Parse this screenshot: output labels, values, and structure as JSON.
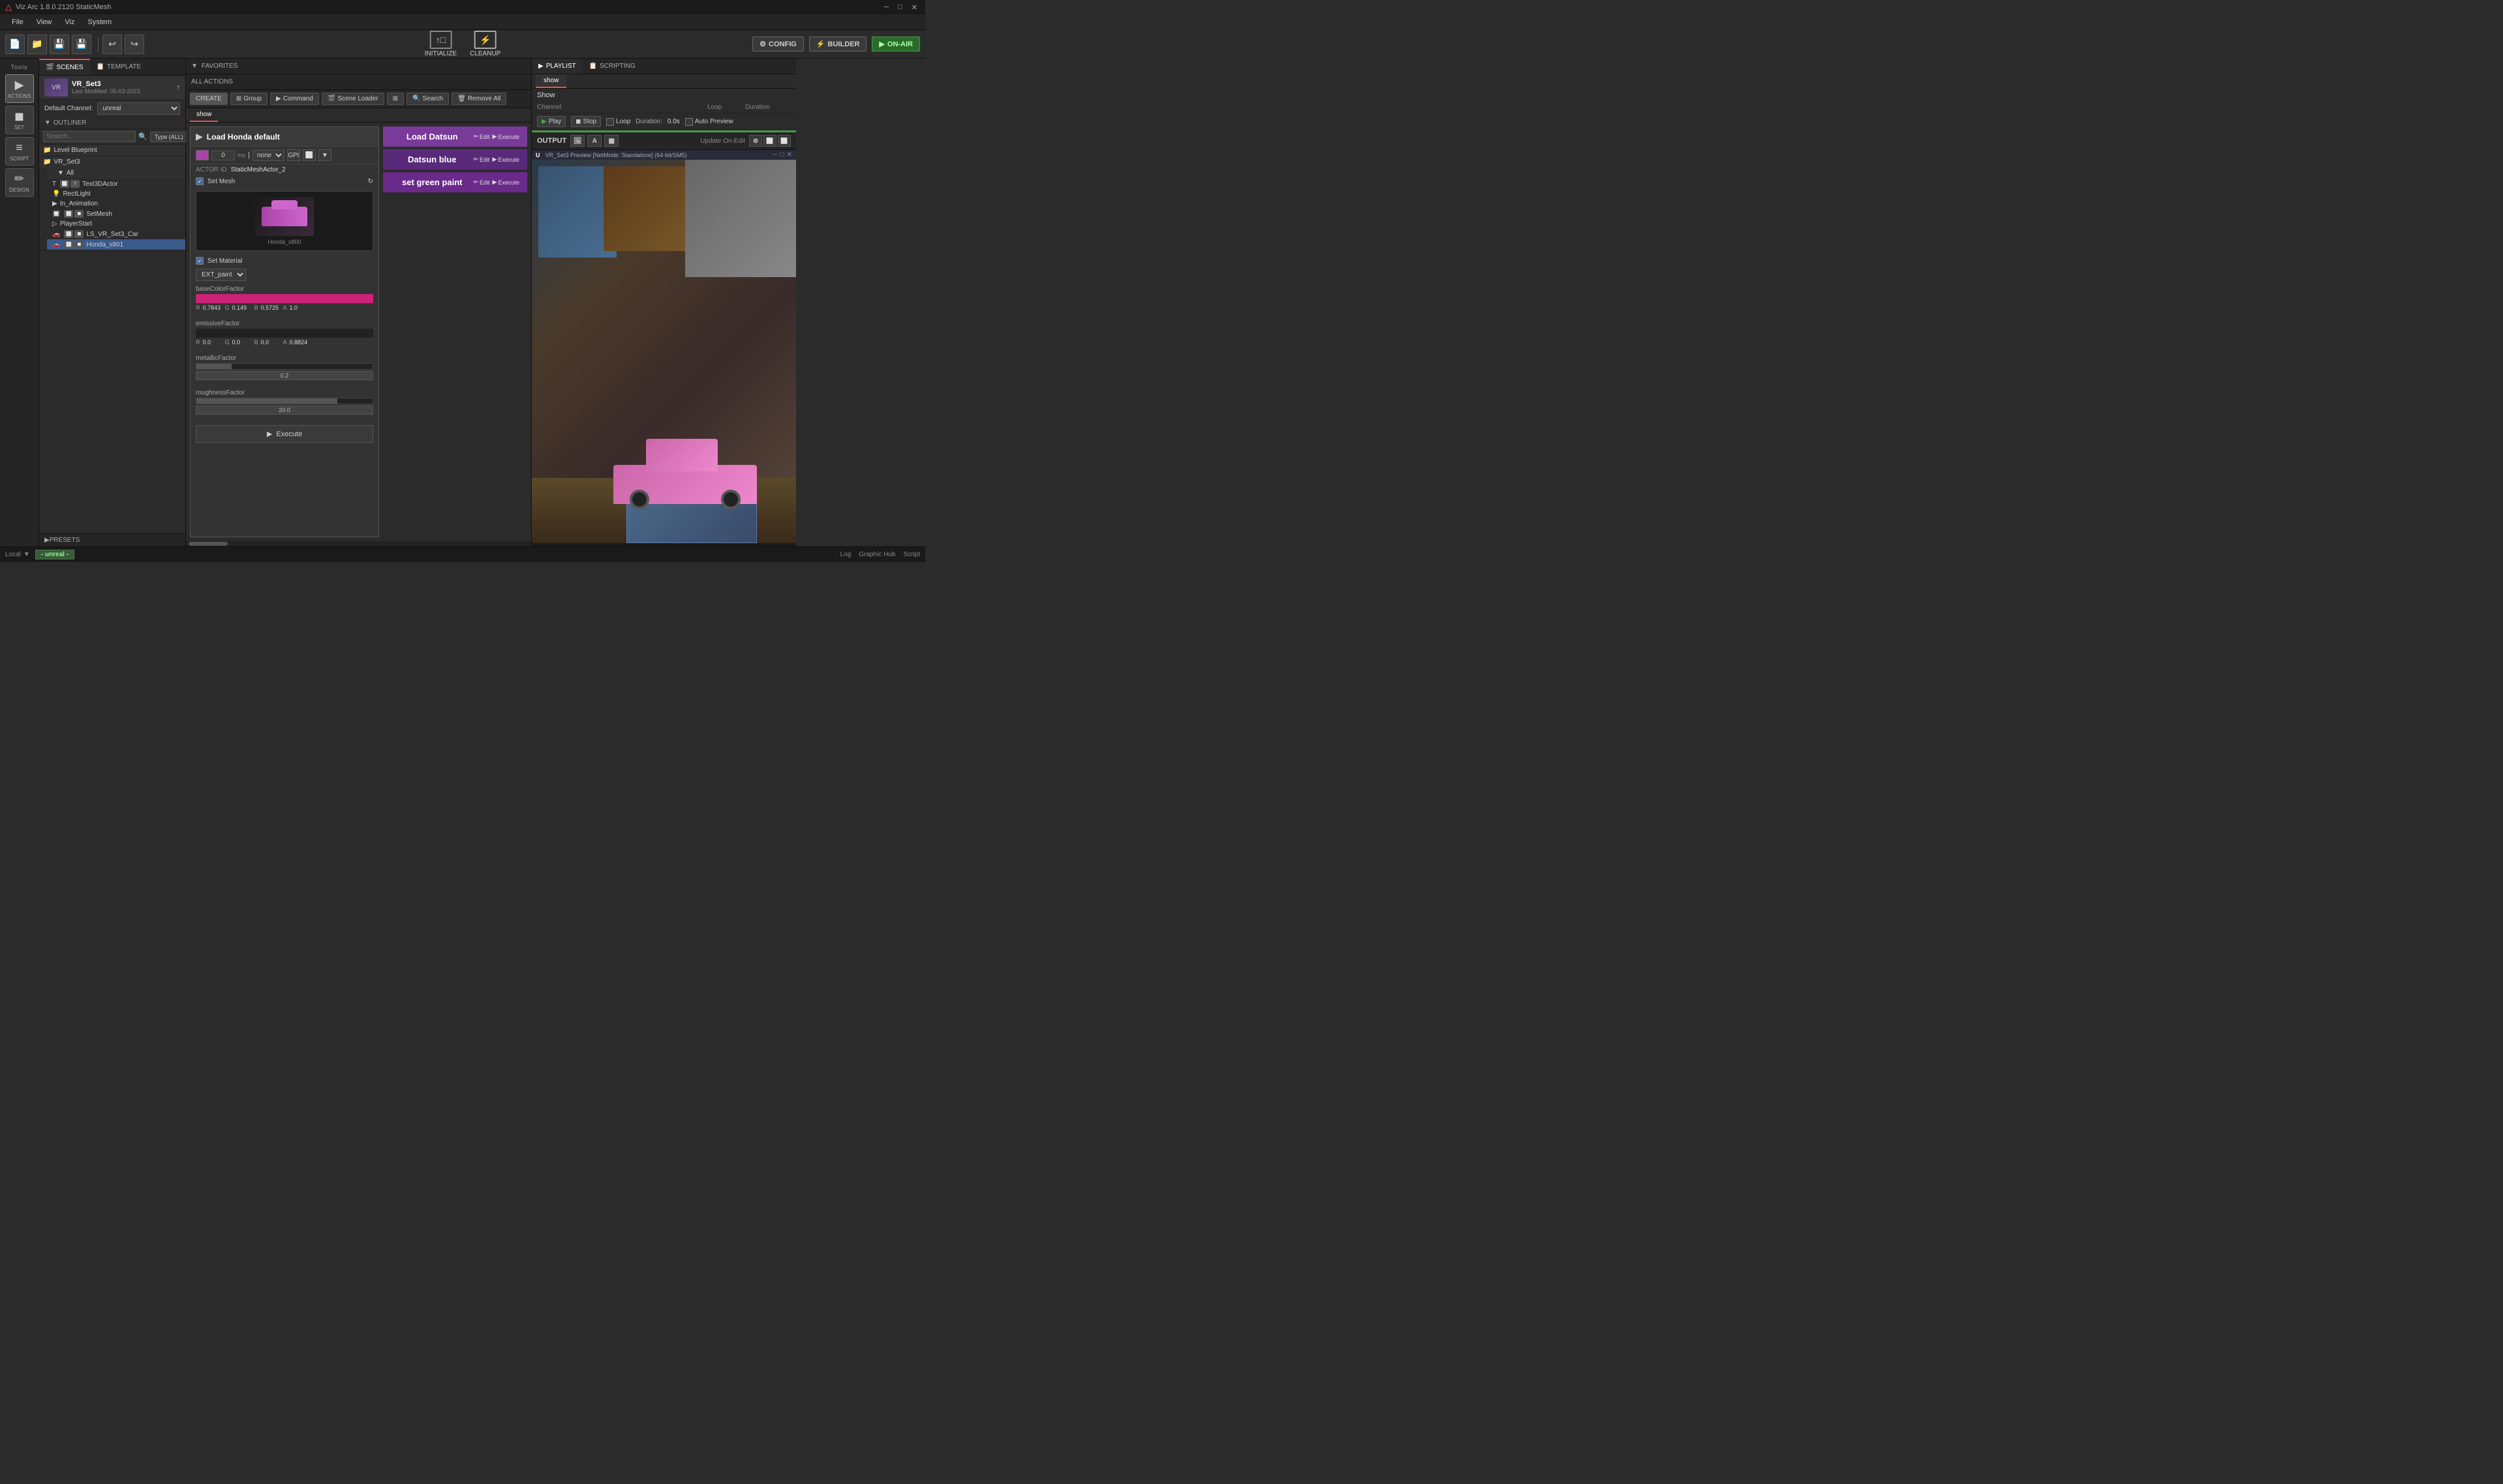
{
  "app": {
    "title": "Viz Arc 1.8.0.2120 StaticMesh",
    "window_controls": [
      "─",
      "□",
      "✕"
    ]
  },
  "menu": {
    "items": [
      "File",
      "View",
      "Viz",
      "System"
    ]
  },
  "toolbar": {
    "center_buttons": [
      {
        "id": "initialize",
        "icon": "↑□",
        "label": "INITIALIZE"
      },
      {
        "id": "cleanup",
        "icon": "⚡",
        "label": "CLEANUP"
      }
    ],
    "right_buttons": [
      {
        "id": "config",
        "icon": "⚙",
        "label": "CONFIG"
      },
      {
        "id": "builder",
        "icon": "⚡",
        "label": "BUILDER"
      },
      {
        "id": "onair",
        "icon": "▶",
        "label": "ON-AIR"
      }
    ]
  },
  "tools": {
    "label": "Tools",
    "items": [
      {
        "id": "actions",
        "icon": "▶",
        "label": "ACTIONS",
        "active": true
      },
      {
        "id": "set",
        "icon": "◼",
        "label": "SET"
      },
      {
        "id": "script",
        "icon": "≡",
        "label": "SCRIPT"
      },
      {
        "id": "design",
        "icon": "✏",
        "label": "DESIGN"
      }
    ]
  },
  "scenes": {
    "tabs": [
      {
        "id": "scenes",
        "icon": "🎬",
        "label": "SCENES",
        "active": true
      },
      {
        "id": "template",
        "icon": "📋",
        "label": "TEMPLATE"
      }
    ],
    "current_scene": {
      "thumb": "VR",
      "name": "VR_Set3",
      "last_modified": "Last Modified: 05-03-2023"
    },
    "default_channel_label": "Default Channel:",
    "default_channel_value": "unreal",
    "outliner": {
      "label": "OUTLINER",
      "search_placeholder": "Search...",
      "type_filter": "Type (ALL)",
      "groups": [
        {
          "id": "level-blueprint",
          "label": "Level Blueprint",
          "items": []
        },
        {
          "id": "vr-set3",
          "label": "VR_Set3",
          "items": [
            {
              "label": "All",
              "children": [
                {
                  "id": "text3d",
                  "label": "Text3DActor",
                  "icons": [
                    "T",
                    "⬜",
                    "T"
                  ]
                },
                {
                  "id": "rectlight",
                  "label": "RectLight",
                  "icons": [
                    "⬜",
                    "💡"
                  ]
                },
                {
                  "id": "in-animation",
                  "label": "In_Animation",
                  "icons": []
                },
                {
                  "id": "setmesh",
                  "label": "SetMesh",
                  "icons": [
                    "⬜",
                    "⬜",
                    "🔲"
                  ]
                },
                {
                  "id": "playerstart",
                  "label": "PlayerStart",
                  "icons": []
                },
                {
                  "id": "ls-car",
                  "label": "LS_VR_Set3_Car",
                  "icons": [
                    "⬜",
                    "⬜",
                    "🔲"
                  ]
                },
                {
                  "id": "honda",
                  "label": "Honda_s801",
                  "icons": [
                    "⬜",
                    "⬜",
                    "🔲"
                  ],
                  "selected": true
                }
              ]
            }
          ]
        }
      ]
    },
    "presets_label": "PRESETS"
  },
  "actions": {
    "all_actions_label": "ALL ACTIONS",
    "toolbar_buttons": [
      {
        "id": "create",
        "label": "CREATE",
        "primary": true
      },
      {
        "id": "group",
        "icon": "⊞",
        "label": "Group"
      },
      {
        "id": "command",
        "icon": "▶",
        "label": "Command"
      },
      {
        "id": "scene-loader",
        "icon": "🎬",
        "label": "Scene Loader"
      },
      {
        "id": "extra",
        "icon": "⊞"
      },
      {
        "id": "search",
        "icon": "🔍",
        "label": "Search"
      },
      {
        "id": "delete",
        "icon": "🗑",
        "label": "Remove All"
      }
    ],
    "active_tab": "show",
    "load_honda_card": {
      "title": "Load Honda default",
      "icon": "▶",
      "color_value": "#aa44aa",
      "num_value": "0",
      "unit": "ms",
      "combo1": "none",
      "actor_id_label": "ACTOR ID",
      "actor_id_value": "StaticMeshActor_2",
      "set_mesh_checked": true,
      "set_mesh_label": "Set Mesh",
      "mesh_name": "Honda_s800",
      "set_material_checked": true,
      "set_material_label": "Set Material",
      "material_value": "EXT_paint",
      "params": [
        {
          "id": "base-color",
          "label": "baseColorFactor",
          "color": "#cc2277",
          "r": "0.7843",
          "g": "0.149",
          "b": "0.5725",
          "a": "1.0"
        },
        {
          "id": "emissive",
          "label": "emissiveFactor",
          "color": "#222222",
          "r": "0.0",
          "g": "0.0",
          "b": "0.0",
          "a": "0.8824"
        },
        {
          "id": "metallic",
          "label": "metallicFactor",
          "slider_value": "0.2",
          "slider_pct": 20
        },
        {
          "id": "roughness",
          "label": "roughnessFactor",
          "slider_value": "20.0",
          "slider_pct": 80
        }
      ],
      "execute_label": "Execute"
    },
    "right_cards": [
      {
        "id": "load-datsun",
        "title": "Load Datsun",
        "style": "purple",
        "edit": "Edit",
        "execute": "Execute"
      },
      {
        "id": "datsun-blue",
        "title": "Datsun blue",
        "style": "dark-purple",
        "edit": "Edit",
        "execute": "Execute"
      },
      {
        "id": "green-paint",
        "title": "set green paint",
        "style": "medium-purple",
        "edit": "Edit",
        "execute": "Execute"
      }
    ]
  },
  "playlist": {
    "tabs": [
      {
        "id": "playlist",
        "icon": "▶",
        "label": "PLAYLIST",
        "active": true
      },
      {
        "id": "scripting",
        "icon": "📋",
        "label": "SCRIPTING"
      }
    ],
    "show_tab": "show",
    "show_label": "Show",
    "col_headers": [
      "Channel",
      "Loop",
      "Duration"
    ],
    "transport": {
      "play_label": "Play",
      "stop_label": "Stop",
      "loop_label": "Loop",
      "duration_label": "Duration:",
      "duration_value": "0.0s",
      "auto_preview_label": "Auto Preview"
    },
    "output": {
      "label": "OUTPUT",
      "update_label": "Update On-Edit",
      "preview_title": "VR_Set3 Preview [NetMode: Standalone] (64-bit/SM5)"
    }
  },
  "statusbar": {
    "local_label": "Local",
    "channel_label": "- unreal -",
    "right_items": [
      "Log",
      "Graphic Hub",
      "Script"
    ]
  }
}
